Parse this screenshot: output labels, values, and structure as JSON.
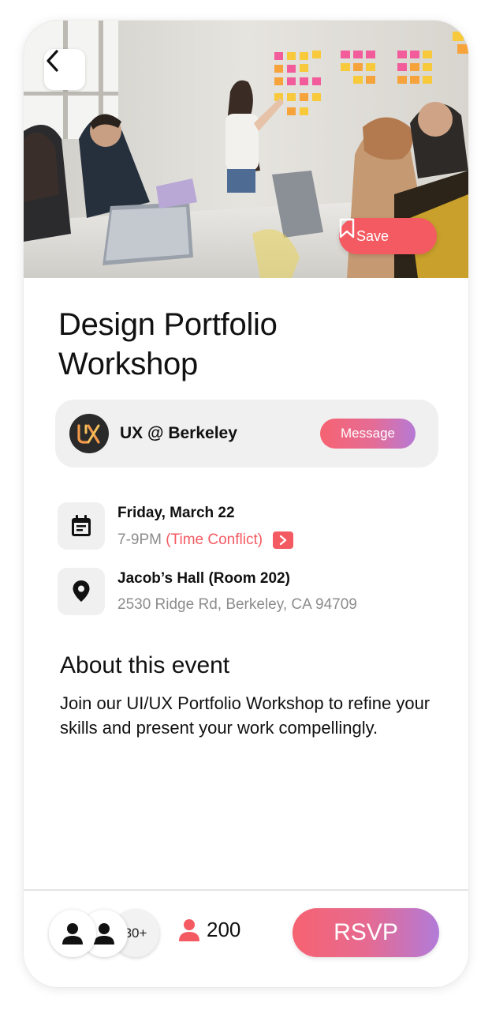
{
  "hero": {
    "save_label": "Save"
  },
  "event": {
    "title": "Design Portfolio Workshop"
  },
  "host": {
    "name": "UX @ Berkeley",
    "message_label": "Message"
  },
  "schedule": {
    "date": "Friday, March 22",
    "time": "7-9PM",
    "conflict": "(Time Conflict)"
  },
  "location": {
    "venue": "Jacob’s Hall (Room 202)",
    "address": "2530 Ridge Rd, Berkeley, CA 94709"
  },
  "about": {
    "heading": "About this event",
    "body": "Join our UI/UX Portfolio Workshop to refine your skills and present your work compellingly."
  },
  "footer": {
    "more_attendees": "30+",
    "attendee_count": "200",
    "rsvp_label": "RSVP"
  },
  "colors": {
    "accent": "#f45a62",
    "gradient_end": "#b27bd9",
    "muted_text": "#8c8c8c",
    "card_bg": "#f0f0f0"
  },
  "icons": [
    "back-arrow-icon",
    "bookmark-icon",
    "ux-berkeley-logo",
    "calendar-icon",
    "chevron-right-icon",
    "location-pin-icon",
    "person-icon"
  ]
}
